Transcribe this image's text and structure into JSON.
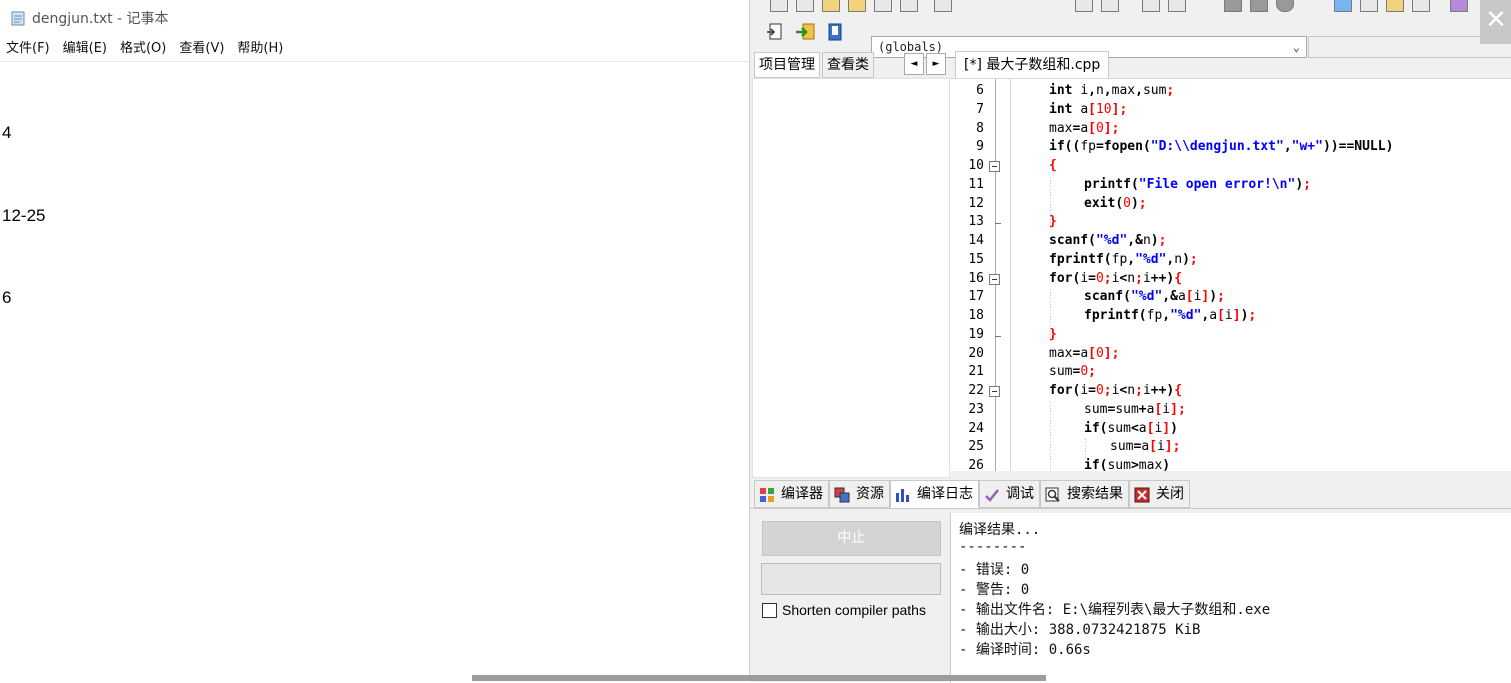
{
  "notepad": {
    "title": "dengjun.txt - 记事本",
    "menu": [
      "文件(F)",
      "编辑(E)",
      "格式(O)",
      "查看(V)",
      "帮助(H)"
    ],
    "lines": [
      "4",
      "12-25",
      "6"
    ]
  },
  "devcpp": {
    "globals_combo": "(globals)",
    "left_tabs": [
      "项目管理",
      "查看类"
    ],
    "tab_arrows": [
      "◄",
      "►"
    ],
    "editor_tab": "[*] 最大子数组和.cpp",
    "code_lines": [
      {
        "n": "6",
        "text": "int i,n,max,sum;"
      },
      {
        "n": "7",
        "text": "int a[10];"
      },
      {
        "n": "8",
        "text": "max=a[0];"
      },
      {
        "n": "9",
        "text": "if((fp=fopen(\"D:\\\\dengjun.txt\",\"w+\"))==NULL)"
      },
      {
        "n": "10",
        "text": "{"
      },
      {
        "n": "11",
        "text": "printf(\"File open error!\\n\");"
      },
      {
        "n": "12",
        "text": "exit(0);"
      },
      {
        "n": "13",
        "text": "}"
      },
      {
        "n": "14",
        "text": "scanf(\"%d\",&n);"
      },
      {
        "n": "15",
        "text": "fprintf(fp,\"%d\",n);"
      },
      {
        "n": "16",
        "text": "for(i=0;i<n;i++){"
      },
      {
        "n": "17",
        "text": "scanf(\"%d\",&a[i]);"
      },
      {
        "n": "18",
        "text": "fprintf(fp,\"%d\",a[i]);"
      },
      {
        "n": "19",
        "text": "}"
      },
      {
        "n": "20",
        "text": "max=a[0];"
      },
      {
        "n": "21",
        "text": "sum=0;"
      },
      {
        "n": "22",
        "text": "for(i=0;i<n;i++){"
      },
      {
        "n": "23",
        "text": "sum=sum+a[i];"
      },
      {
        "n": "24",
        "text": "if(sum<a[i])"
      },
      {
        "n": "25",
        "text": "sum=a[i];"
      },
      {
        "n": "26",
        "text": "if(sum>max)"
      }
    ],
    "bottom_tabs": [
      {
        "label": "编译器",
        "icon": "grid-icon"
      },
      {
        "label": "资源",
        "icon": "resources-icon"
      },
      {
        "label": "编译日志",
        "icon": "bar-chart-icon"
      },
      {
        "label": "调试",
        "icon": "check-icon"
      },
      {
        "label": "搜索结果",
        "icon": "search-icon"
      },
      {
        "label": "关闭",
        "icon": "close-icon"
      }
    ],
    "abort_button": "中止",
    "shorten_label": "Shorten compiler paths",
    "log_lines": [
      "编译结果...",
      "--------",
      "- 错误: 0",
      "- 警告: 0",
      "- 输出文件名: E:\\编程列表\\最大子数组和.exe",
      "- 输出大小: 388.0732421875 KiB",
      "- 编译时间: 0.66s"
    ],
    "close_glyph": "✕"
  },
  "colors": {
    "keyword": "#000000",
    "string": "#0000ff",
    "number": "#ff0000",
    "symbol": "#ff0000"
  }
}
